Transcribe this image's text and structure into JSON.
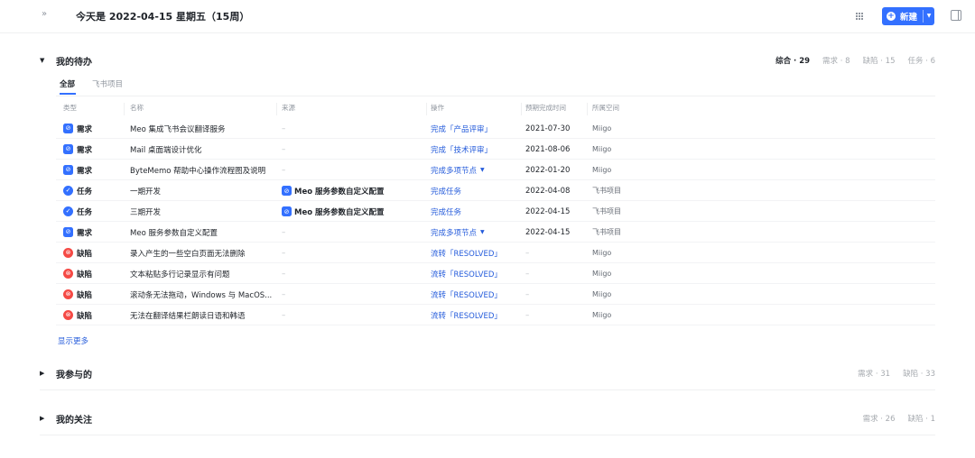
{
  "header": {
    "expand_icon": "double-chevron-right-icon",
    "title": "今天是 2022-04-15 星期五（15周）",
    "new_button": "新建",
    "accent_color": "#3370ff"
  },
  "todo": {
    "title": "我的待办",
    "stats": [
      {
        "label": "综合 · 29",
        "active": true
      },
      {
        "label": "需求 · 8",
        "active": false
      },
      {
        "label": "缺陷 · 15",
        "active": false
      },
      {
        "label": "任务 · 6",
        "active": false
      }
    ],
    "tabs": [
      "全部",
      "飞书项目"
    ],
    "columns": [
      "类型",
      "名称",
      "来源",
      "操作",
      "预期完成时间",
      "所属空间"
    ],
    "rows": [
      {
        "type": "需求",
        "kind": "req",
        "name": "Meo 集成飞书会议翻译服务",
        "source": "–",
        "source_linked": false,
        "action": "完成「产品评审」",
        "has_dropdown": false,
        "date": "2021-07-30",
        "space": "Miigo"
      },
      {
        "type": "需求",
        "kind": "req",
        "name": "Mail 桌面端设计优化",
        "source": "–",
        "source_linked": false,
        "action": "完成「技术评审」",
        "has_dropdown": false,
        "date": "2021-08-06",
        "space": "Miigo"
      },
      {
        "type": "需求",
        "kind": "req",
        "name": "ByteMemo 帮助中心操作流程图及说明",
        "source": "–",
        "source_linked": false,
        "action": "完成多项节点",
        "has_dropdown": true,
        "date": "2022-01-20",
        "space": "Miigo"
      },
      {
        "type": "任务",
        "kind": "task",
        "name": "一期开发",
        "source": "Meo 服务参数自定义配置",
        "source_linked": true,
        "action": "完成任务",
        "has_dropdown": false,
        "date": "2022-04-08",
        "space": "飞书项目"
      },
      {
        "type": "任务",
        "kind": "task",
        "name": "三期开发",
        "source": "Meo 服务参数自定义配置",
        "source_linked": true,
        "action": "完成任务",
        "has_dropdown": false,
        "date": "2022-04-15",
        "space": "飞书项目"
      },
      {
        "type": "需求",
        "kind": "req",
        "name": "Meo 服务参数自定义配置",
        "source": "–",
        "source_linked": false,
        "action": "完成多项节点",
        "has_dropdown": true,
        "date": "2022-04-15",
        "space": "飞书项目"
      },
      {
        "type": "缺陷",
        "kind": "bug",
        "name": "录入产生的一些空白页面无法删除",
        "source": "–",
        "source_linked": false,
        "action": "流转「RESOLVED」",
        "has_dropdown": false,
        "date": "–",
        "space": "Miigo"
      },
      {
        "type": "缺陷",
        "kind": "bug",
        "name": "文本粘贴多行记录显示有问题",
        "source": "–",
        "source_linked": false,
        "action": "流转「RESOLVED」",
        "has_dropdown": false,
        "date": "–",
        "space": "Miigo"
      },
      {
        "type": "缺陷",
        "kind": "bug",
        "name": "滚动条无法拖动，Windows 与 MacOS...",
        "source": "–",
        "source_linked": false,
        "action": "流转「RESOLVED」",
        "has_dropdown": false,
        "date": "–",
        "space": "Miigo"
      },
      {
        "type": "缺陷",
        "kind": "bug",
        "name": "无法在翻译结果栏朗读日语和韩语",
        "source": "–",
        "source_linked": false,
        "action": "流转「RESOLVED」",
        "has_dropdown": false,
        "date": "–",
        "space": "Miigo"
      }
    ],
    "show_more": "显示更多"
  },
  "participated": {
    "title": "我参与的",
    "stats": [
      "需求 · 31",
      "缺陷 · 33"
    ]
  },
  "following": {
    "title": "我的关注",
    "stats": [
      "需求 · 26",
      "缺陷 · 1"
    ]
  }
}
